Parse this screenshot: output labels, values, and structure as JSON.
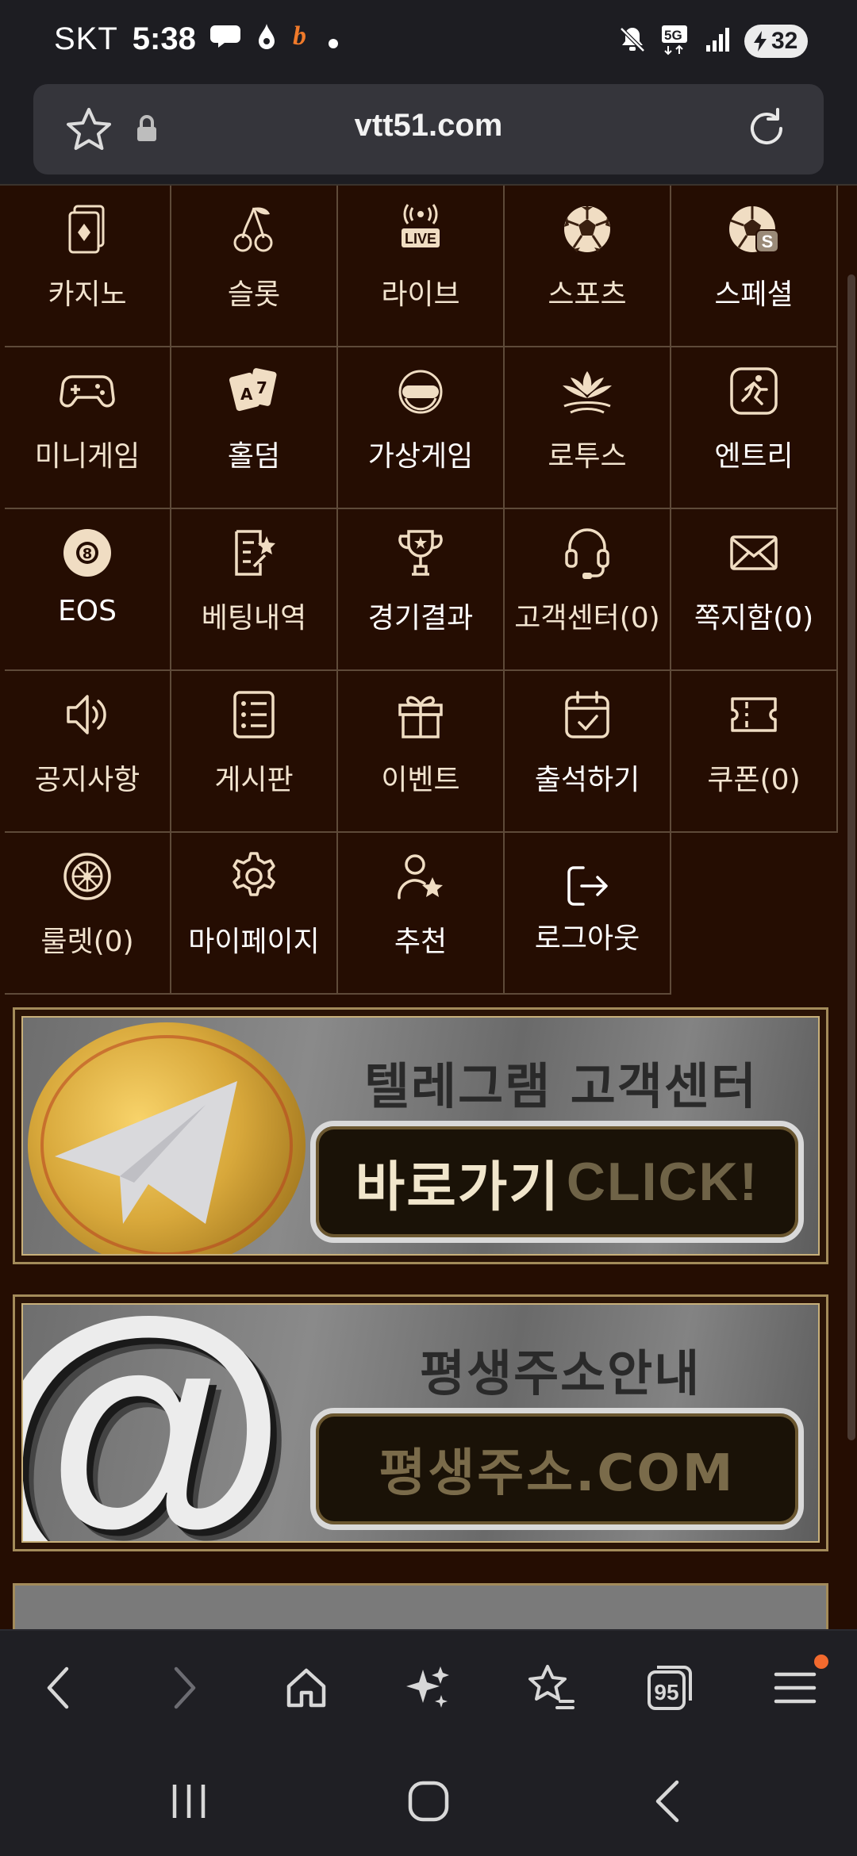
{
  "status": {
    "carrier": "SKT",
    "time": "5:38",
    "network": "5G",
    "battery": "32"
  },
  "browser": {
    "url": "vtt51.com",
    "tab_count": "95"
  },
  "menu": [
    {
      "label": "카지노",
      "icon": "casino-card-icon"
    },
    {
      "label": "슬롯",
      "icon": "cherry-icon"
    },
    {
      "label": "라이브",
      "icon": "live-broadcast-icon"
    },
    {
      "label": "스포츠",
      "icon": "soccer-ball-icon"
    },
    {
      "label": "스페셜",
      "icon": "special-soccer-icon"
    },
    {
      "label": "미니게임",
      "icon": "gamepad-icon"
    },
    {
      "label": "홀덤",
      "icon": "poker-cards-icon"
    },
    {
      "label": "가상게임",
      "icon": "vr-headset-icon"
    },
    {
      "label": "로투스",
      "icon": "lotus-icon"
    },
    {
      "label": "엔트리",
      "icon": "entry-runner-icon"
    },
    {
      "label": "EOS",
      "icon": "eight-ball-icon"
    },
    {
      "label": "베팅내역",
      "icon": "betting-history-icon"
    },
    {
      "label": "경기결과",
      "icon": "trophy-icon"
    },
    {
      "label": "고객센터(0)",
      "icon": "headset-icon"
    },
    {
      "label": "쪽지함(0)",
      "icon": "envelope-icon"
    },
    {
      "label": "공지사항",
      "icon": "speaker-icon"
    },
    {
      "label": "게시판",
      "icon": "list-board-icon"
    },
    {
      "label": "이벤트",
      "icon": "gift-icon"
    },
    {
      "label": "출석하기",
      "icon": "calendar-check-icon"
    },
    {
      "label": "쿠폰(0)",
      "icon": "coupon-icon"
    },
    {
      "label": "룰렛(0)",
      "icon": "roulette-icon"
    },
    {
      "label": "마이페이지",
      "icon": "gear-icon"
    },
    {
      "label": "추천",
      "icon": "user-star-icon"
    },
    {
      "label": "로그아웃",
      "icon": "logout-icon"
    }
  ],
  "banners": {
    "telegram": {
      "title": "텔레그램 고객센터",
      "button_main": "바로가기",
      "button_sub": "CLICK!"
    },
    "address": {
      "title": "평생주소안내",
      "button": "평생주소.COM",
      "icon": "at-sign-icon"
    }
  },
  "colors": {
    "page_bg": "#250d02",
    "gold": "#f0ddc3",
    "grid_line": "#5e4a39"
  }
}
